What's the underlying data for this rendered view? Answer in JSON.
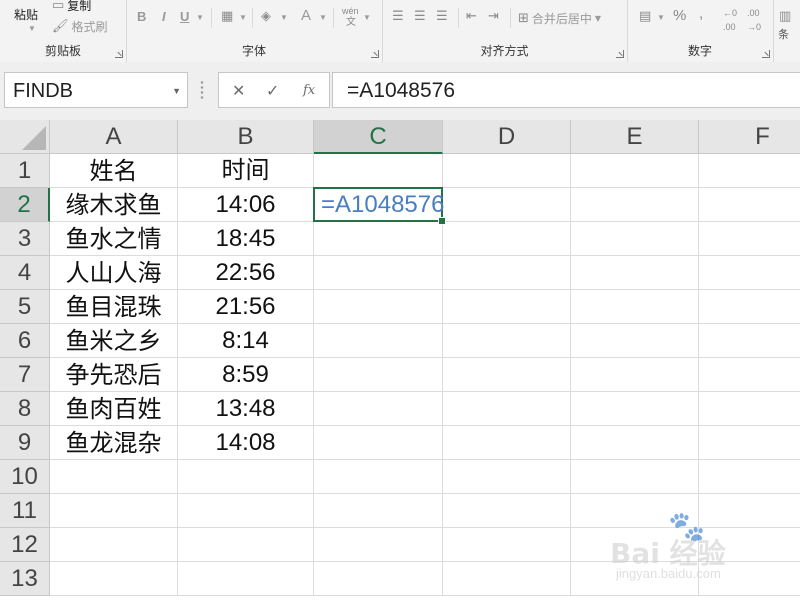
{
  "ribbon": {
    "clipboard": {
      "group_label": "剪贴板",
      "paste_label": "粘贴",
      "copy_label": "复制",
      "format_painter_label": "格式刷"
    },
    "font": {
      "group_label": "字体",
      "bold": "B",
      "italic": "I",
      "underline": "U",
      "font_color": "A",
      "phonetic": "wén"
    },
    "alignment": {
      "group_label": "对齐方式",
      "merge_label": "合并后居中"
    },
    "number": {
      "group_label": "数字",
      "percent": "%",
      "comma": ","
    },
    "styles": {
      "group_label": "条"
    }
  },
  "formula_bar": {
    "name_box": "FINDB",
    "cancel_symbol": "✕",
    "enter_symbol": "✓",
    "fx_symbol": "fx",
    "formula": "=A1048576"
  },
  "sheet": {
    "columns": [
      "A",
      "B",
      "C",
      "D",
      "E",
      "F"
    ],
    "rows": [
      "1",
      "2",
      "3",
      "4",
      "5",
      "6",
      "7",
      "8",
      "9",
      "10",
      "11",
      "12",
      "13"
    ],
    "selected_column": "C",
    "selected_row": "2",
    "active_cell_text": "=A1048576",
    "col_a": [
      "姓名",
      "缘木求鱼",
      "鱼水之情",
      "人山人海",
      "鱼目混珠",
      "鱼米之乡",
      "争先恐后",
      "鱼肉百姓",
      "鱼龙混杂"
    ],
    "col_b": [
      "时间",
      "14:06",
      "18:45",
      "22:56",
      "21:56",
      "8:14",
      "8:59",
      "13:48",
      "14:08"
    ]
  },
  "watermark": {
    "logo_text": "Bai 经验",
    "url_text": "jingyan.baidu.com"
  }
}
